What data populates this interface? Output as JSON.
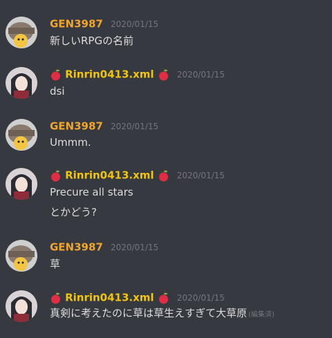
{
  "colors": {
    "background": "#36393f",
    "author_gen": "#f1a52e",
    "author_rin": "#f1c40f",
    "timestamp": "#72767d",
    "text": "#dcddde"
  },
  "icons": {
    "apple": "red-apple-icon"
  },
  "messages": [
    {
      "author": "GEN3987",
      "timestamp": "2020/01/15",
      "lines": [
        "新しいRPGの名前"
      ]
    },
    {
      "author": "Rinrin0413.xml",
      "timestamp": "2020/01/15",
      "lines": [
        "dsi"
      ]
    },
    {
      "author": "GEN3987",
      "timestamp": "2020/01/15",
      "lines": [
        "Ummm."
      ]
    },
    {
      "author": "Rinrin0413.xml",
      "timestamp": "2020/01/15",
      "lines": [
        "Precure all stars",
        "とかどう?"
      ]
    },
    {
      "author": "GEN3987",
      "timestamp": "2020/01/15",
      "lines": [
        "草"
      ]
    },
    {
      "author": "Rinrin0413.xml",
      "timestamp": "2020/01/15",
      "lines": [
        "真剣に考えたのに草は草生えすぎて大草原"
      ],
      "edited": "(編集済)"
    }
  ]
}
